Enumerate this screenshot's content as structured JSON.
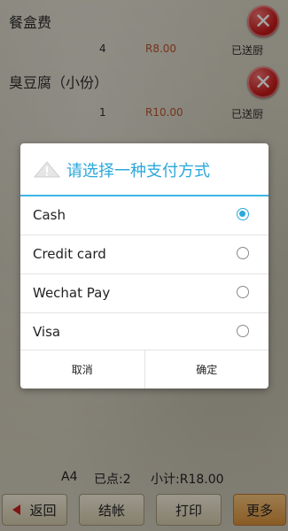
{
  "order_items": [
    {
      "name": "餐盒费",
      "qty": "4",
      "price": "R8.00",
      "status": "已送厨"
    },
    {
      "name": "臭豆腐（小份）",
      "qty": "1",
      "price": "R10.00",
      "status": "已送厨"
    }
  ],
  "dialog": {
    "title": "请选择一种支付方式",
    "options": [
      {
        "label": "Cash",
        "selected": true
      },
      {
        "label": "Credit card",
        "selected": false
      },
      {
        "label": "Wechat Pay",
        "selected": false
      },
      {
        "label": "Visa",
        "selected": false
      }
    ],
    "cancel_label": "取消",
    "confirm_label": "确定"
  },
  "summary": {
    "table": "A4",
    "ordered": "已点:2",
    "subtotal": "小计:R18.00"
  },
  "toolbar": {
    "back_label": "返回",
    "checkout_label": "结帐",
    "print_label": "打印",
    "more_label": "更多"
  },
  "colors": {
    "accent": "#2ba8da",
    "price": "#b4502b",
    "delete": "#c51b1b"
  }
}
